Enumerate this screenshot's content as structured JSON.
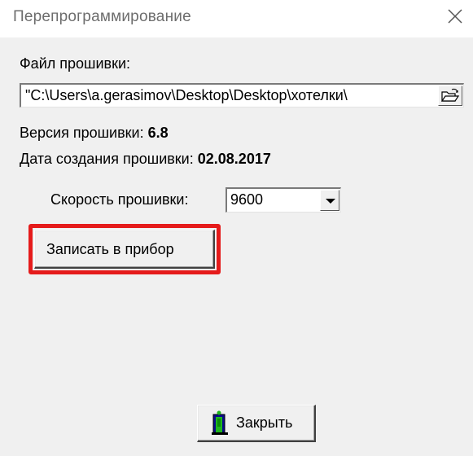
{
  "window": {
    "title": "Перепрограммирование"
  },
  "firmware_file": {
    "label": "Файл прошивки:",
    "path": "\"C:\\Users\\a.gerasimov\\Desktop\\Desktop\\хотелки\\"
  },
  "firmware_version": {
    "label": "Версия прошивки:",
    "value": "6.8"
  },
  "firmware_date": {
    "label": "Дата создания прошивки:",
    "value": "02.08.2017"
  },
  "speed": {
    "label": "Скорость прошивки:",
    "selected": "9600"
  },
  "buttons": {
    "write": "Записать в прибор",
    "close": "Закрыть"
  },
  "colors": {
    "highlight": "#e51b1b"
  }
}
